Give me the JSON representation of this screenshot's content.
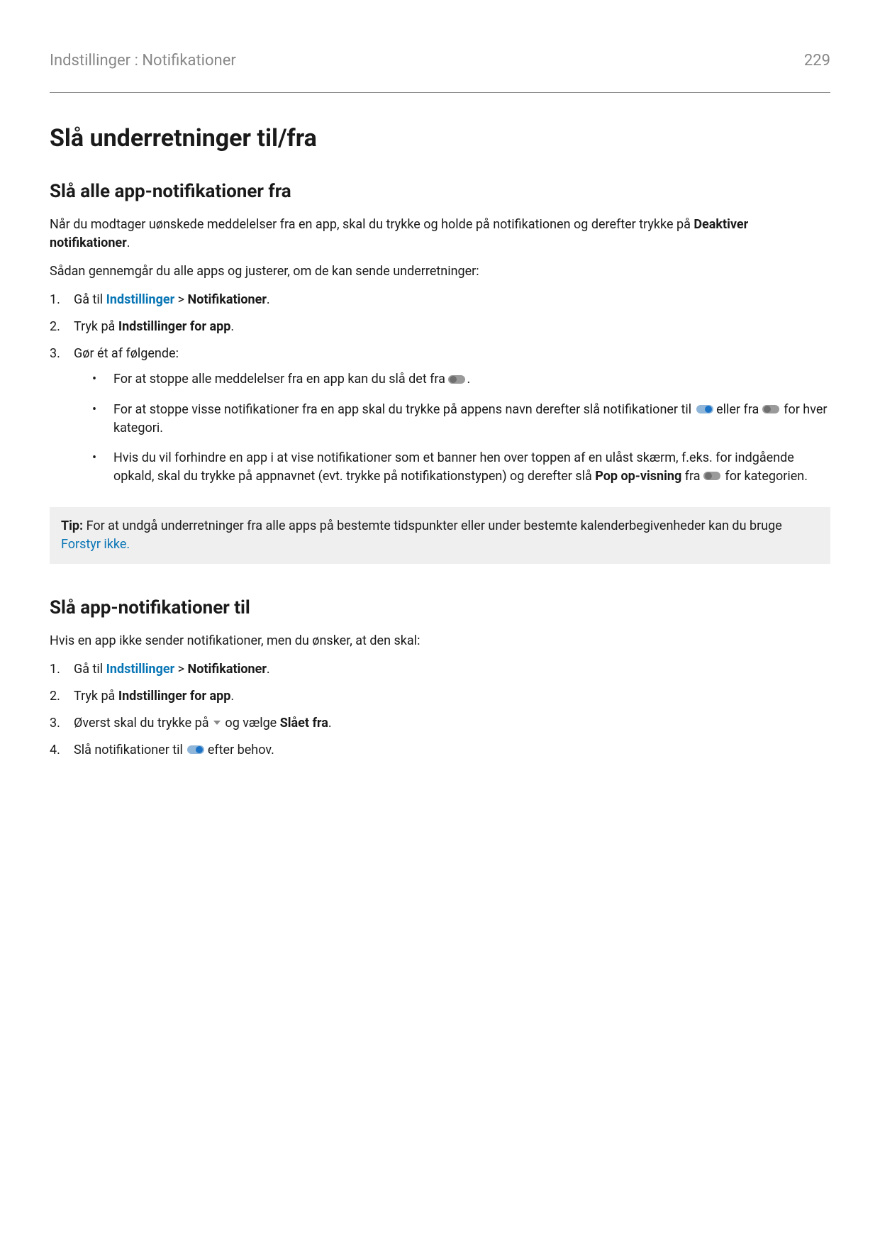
{
  "header": {
    "breadcrumb": "Indstillinger : Notifikationer",
    "page_number": "229"
  },
  "title": "Slå underretninger til/fra",
  "section_off": {
    "heading": "Slå alle app-notifikationer fra",
    "intro_pre": "Når du modtager uønskede meddelelser fra en app, skal du trykke og holde på notifikationen og derefter trykke på ",
    "intro_bold": "Deaktiver notifikationer",
    "intro_post": ".",
    "review_line": "Sådan gennemgår du alle apps og justerer, om de kan sende underretninger:",
    "step1_num": "1.",
    "step1_pre": "Gå til ",
    "step1_link": "Indstillinger",
    "step1_sep": " > ",
    "step1_bold": "Notifikationer",
    "step1_post": ".",
    "step2_num": "2.",
    "step2_pre": "Tryk på ",
    "step2_bold": "Indstillinger for app",
    "step2_post": ".",
    "step3_num": "3.",
    "step3_text": "Gør ét af følgende:",
    "b1_pre": "For at stoppe alle meddelelser fra en app kan du slå det fra ",
    "b1_post": ".",
    "b2_pre": "For at stoppe visse notifikationer fra en app skal du trykke på appens navn derefter slå notifikationer til ",
    "b2_mid": " eller fra ",
    "b2_post": " for hver kategori.",
    "b3_pre": "Hvis du vil forhindre en app i at vise notifikationer som et banner hen over toppen af en ulåst skærm, f.eks. for indgående opkald, skal du trykke på appnavnet (evt. trykke på notifikationstypen) og derefter slå ",
    "b3_bold": "Pop op-visning",
    "b3_mid": " fra ",
    "b3_post": " for kategorien."
  },
  "tip": {
    "label": "Tip:",
    "text": " For at undgå underretninger fra alle apps på bestemte tidspunkter eller under bestemte kalenderbegivenheder kan du bruge ",
    "link": "Forstyr ikke."
  },
  "section_on": {
    "heading": "Slå app-notifikationer til",
    "intro": "Hvis en app ikke sender notifikationer, men du ønsker, at den skal:",
    "step1_num": "1.",
    "step1_pre": "Gå til ",
    "step1_link": "Indstillinger",
    "step1_sep": " > ",
    "step1_bold": "Notifikationer",
    "step1_post": ".",
    "step2_num": "2.",
    "step2_pre": "Tryk på ",
    "step2_bold": "Indstillinger for app",
    "step2_post": ".",
    "step3_num": "3.",
    "step3_pre": "Øverst skal du trykke på ",
    "step3_mid": " og vælge ",
    "step3_bold": "Slået fra",
    "step3_post": ".",
    "step4_num": "4.",
    "step4_pre": "Slå notifikationer til ",
    "step4_post": " efter behov."
  }
}
